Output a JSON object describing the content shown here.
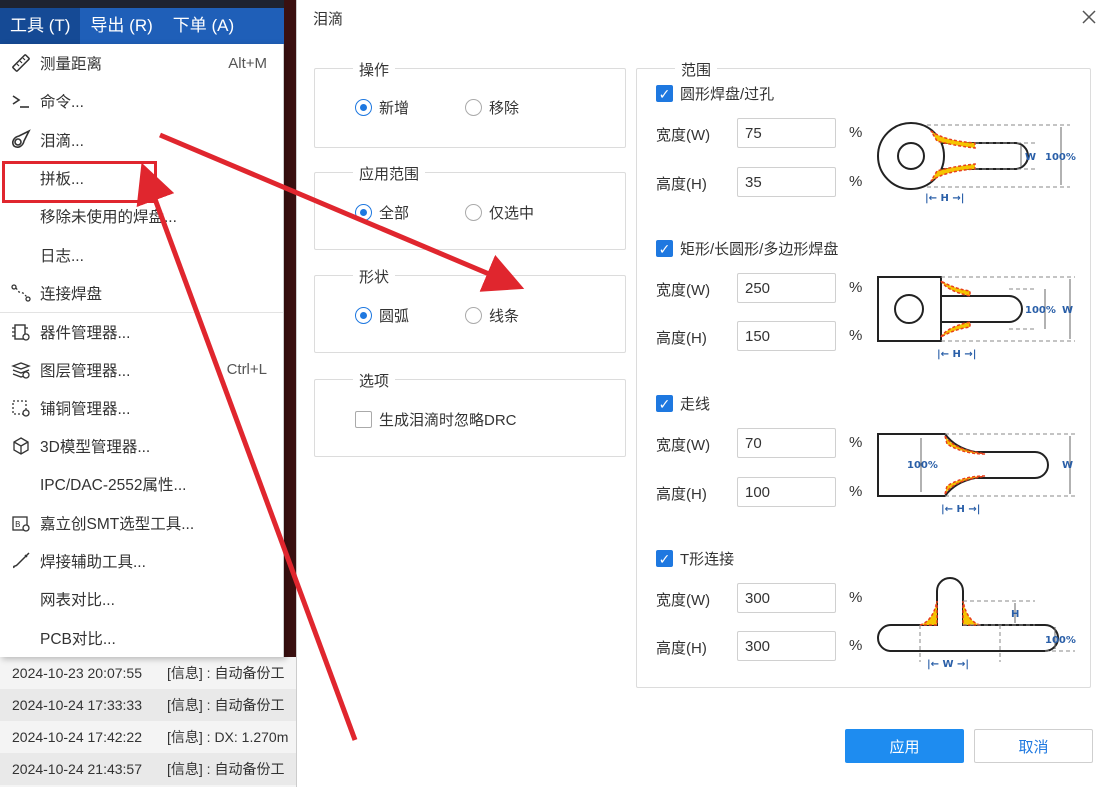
{
  "menubar": {
    "items": [
      "工具 (T)",
      "导出 (R)",
      "下单 (A)"
    ]
  },
  "menu": {
    "items": [
      {
        "label": "测量距离",
        "shortcut": "Alt+M",
        "icon": "ruler-icon"
      },
      {
        "label": "命令...",
        "shortcut": "",
        "icon": "command-prompt-icon"
      },
      {
        "label": "泪滴...",
        "shortcut": "",
        "icon": "teardrop-icon"
      },
      {
        "label": "拼板...",
        "shortcut": "",
        "icon": ""
      },
      {
        "label": "移除未使用的焊盘...",
        "shortcut": "",
        "icon": ""
      },
      {
        "label": "日志...",
        "shortcut": "",
        "icon": ""
      },
      {
        "label": "连接焊盘",
        "shortcut": "",
        "icon": "connect-pads-icon"
      },
      {
        "label": "器件管理器...",
        "shortcut": "",
        "icon": "component-manager-icon"
      },
      {
        "label": "图层管理器...",
        "shortcut": "Ctrl+L",
        "icon": "layer-manager-icon"
      },
      {
        "label": "铺铜管理器...",
        "shortcut": "",
        "icon": "copper-pour-icon"
      },
      {
        "label": "3D模型管理器...",
        "shortcut": "",
        "icon": "3d-model-icon"
      },
      {
        "label": "IPC/DAC-2552属性...",
        "shortcut": "",
        "icon": ""
      },
      {
        "label": "嘉立创SMT选型工具...",
        "shortcut": "",
        "icon": "smt-tool-icon"
      },
      {
        "label": "焊接辅助工具...",
        "shortcut": "",
        "icon": "soldering-iron-icon"
      },
      {
        "label": "网表对比...",
        "shortcut": "",
        "icon": ""
      },
      {
        "label": "PCB对比...",
        "shortcut": "",
        "icon": ""
      }
    ]
  },
  "log": {
    "rows": [
      {
        "time": "2024-10-23 20:07:55",
        "msg": "[信息] : 自动备份工"
      },
      {
        "time": "2024-10-24 17:33:33",
        "msg": "[信息] : 自动备份工"
      },
      {
        "time": "2024-10-24 17:42:22",
        "msg": "[信息] : DX: 1.270m"
      },
      {
        "time": "2024-10-24 21:43:57",
        "msg": "[信息] : 自动备份工"
      }
    ]
  },
  "dialog": {
    "title": "泪滴",
    "operation": {
      "title": "操作",
      "options": [
        "新增",
        "移除"
      ],
      "selected": 0
    },
    "apply_scope": {
      "title": "应用范围",
      "options": [
        "全部",
        "仅选中"
      ],
      "selected": 0
    },
    "shape": {
      "title": "形状",
      "options": [
        "圆弧",
        "线条"
      ],
      "selected": 0
    },
    "options": {
      "title": "选项",
      "ignore_drc_label": "生成泪滴时忽略DRC",
      "ignore_drc_checked": false
    },
    "range": {
      "title": "范围",
      "width_label": "宽度(W)",
      "height_label": "高度(H)",
      "percent": "%",
      "sections": [
        {
          "label": "圆形焊盘/过孔",
          "checked": true,
          "width": "75",
          "height": "35"
        },
        {
          "label": "矩形/长圆形/多边形焊盘",
          "checked": true,
          "width": "250",
          "height": "150"
        },
        {
          "label": "走线",
          "checked": true,
          "width": "70",
          "height": "100"
        },
        {
          "label": "T形连接",
          "checked": true,
          "width": "300",
          "height": "300"
        }
      ]
    },
    "diagram_labels": {
      "w": "W",
      "h": "H",
      "full": "100%",
      "arrow_h": "|← H →|",
      "arrow_w": "|← W →|"
    },
    "apply_label": "应用",
    "cancel_label": "取消"
  },
  "colors": {
    "accent": "#1e78e0",
    "menubar": "#1f5fb8",
    "annotation": "#e0262e",
    "teardrop_fill": "#f5c400",
    "teardrop_edge": "#e8401c"
  }
}
